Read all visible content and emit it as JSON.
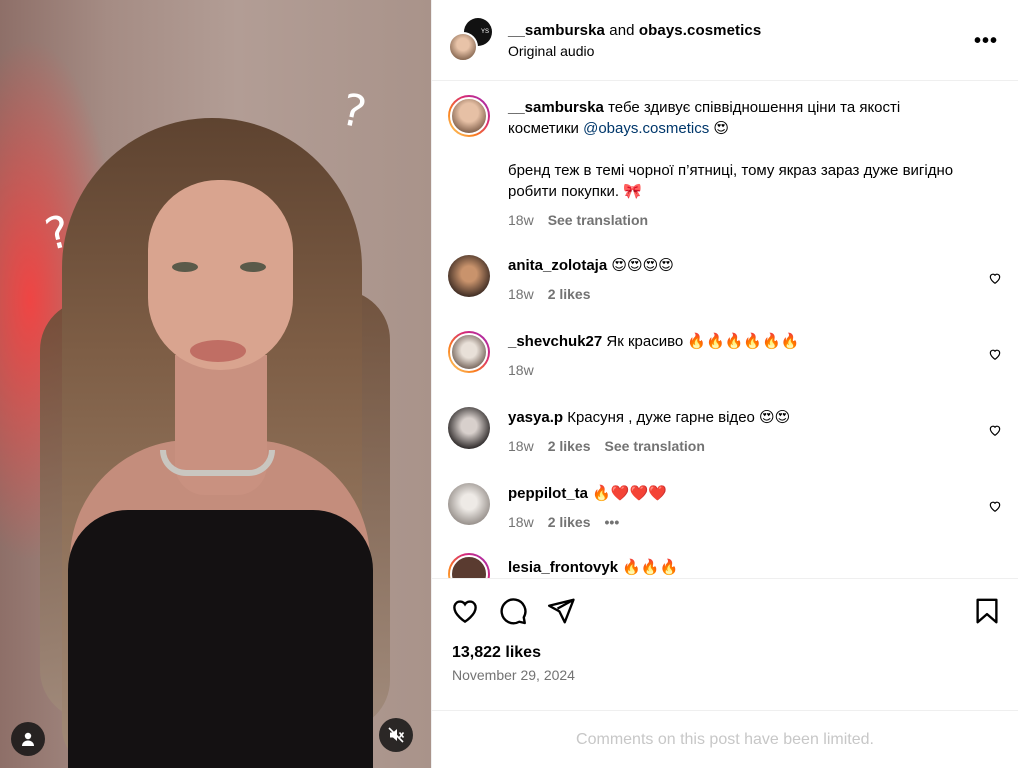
{
  "post": {
    "author": "__samburska",
    "conjunction": "and",
    "coauthor": "obays.cosmetics",
    "audio": "Original audio",
    "likes": "13,822 likes",
    "date": "November 29, 2024",
    "comments_limited": "Comments on this post have been limited."
  },
  "caption": {
    "user": "__samburska",
    "text_1": "тебе здивує співвідношення ціни та якості косметики",
    "mention": "@obays.cosmetics",
    "emoji_1": "😍",
    "text_2": "бренд теж в темі чорної п’ятниці, тому якраз зараз дуже вигідно робити покупки.",
    "emoji_2": "🎀",
    "time": "18w",
    "see_translation": "See translation"
  },
  "comments": [
    {
      "user": "anita_zolotaja",
      "text": "😍😍😍😍",
      "time": "18w",
      "likes": "2 likes"
    },
    {
      "user": "_shevchuk27",
      "text": "Як красиво 🔥🔥🔥🔥🔥🔥",
      "time": "18w"
    },
    {
      "user": "yasya.p",
      "text": "Красуня , дуже гарне відео 😍😍",
      "time": "18w",
      "likes": "2 likes",
      "see_translation": "See translation"
    },
    {
      "user": "peppilot_ta",
      "text": "🔥❤️❤️❤️",
      "time": "18w",
      "likes": "2 likes",
      "more": "•••"
    },
    {
      "user": "lesia_frontovyk",
      "text": "🔥🔥🔥"
    }
  ],
  "media": {
    "qmarks": [
      "?",
      "?"
    ]
  },
  "icons": [
    "more-options-icon",
    "like-icon",
    "comment-icon",
    "share-icon",
    "save-icon",
    "heart-small-icon",
    "user-tag-icon",
    "mute-icon"
  ],
  "colors": {
    "mention": "#00376b",
    "muted": "#737373",
    "story_ring": "#d62976"
  }
}
